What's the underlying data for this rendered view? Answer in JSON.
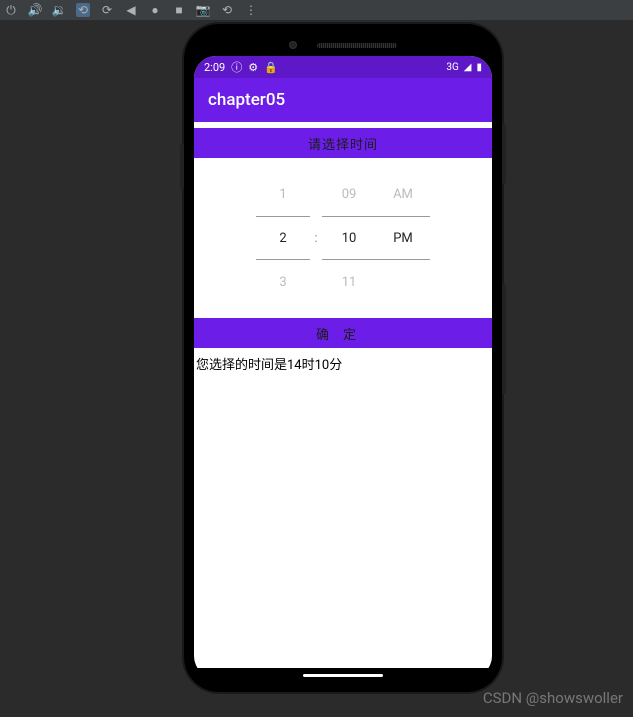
{
  "toolbar": {
    "icons": [
      "power",
      "volume-up",
      "volume-down",
      "rotate-left",
      "rotate-right",
      "play-back",
      "record",
      "stop",
      "camera",
      "rewind",
      "more"
    ]
  },
  "status_bar": {
    "time": "2:09",
    "network": "3G"
  },
  "app_bar": {
    "title": "chapter05"
  },
  "buttons": {
    "select_time": "请选择时间",
    "confirm": "确定"
  },
  "picker": {
    "hour_prev": "1",
    "hour_sel": "2",
    "hour_next": "3",
    "min_prev": "09",
    "min_sel": "10",
    "min_next": "11",
    "ampm_prev": "AM",
    "ampm_sel": "PM",
    "colon": ":"
  },
  "result": "您选择的时间是14时10分",
  "watermark": "CSDN @showswoller"
}
